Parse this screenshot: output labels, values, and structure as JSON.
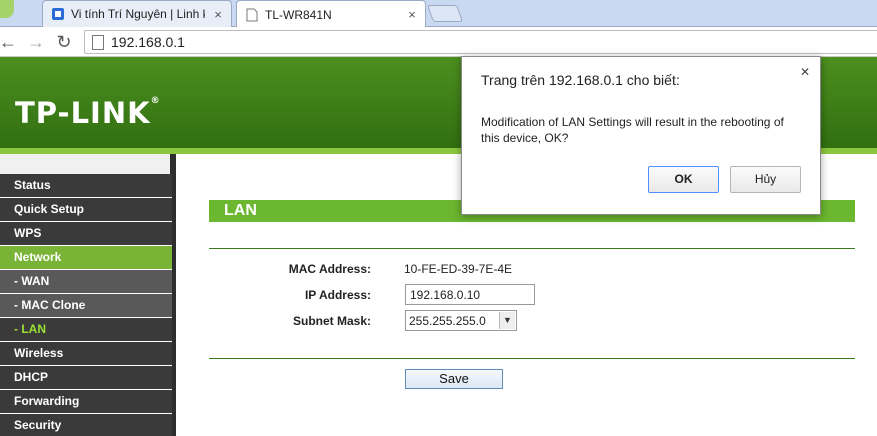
{
  "browser": {
    "tabs": [
      {
        "title": "Vi tính Trí Nguyên | Linh k",
        "active": false
      },
      {
        "title": "TL-WR841N",
        "active": true
      }
    ],
    "address": "192.168.0.1"
  },
  "router": {
    "logo": "TP-LINK",
    "sidebar": [
      {
        "label": "Status",
        "state": "normal"
      },
      {
        "label": "Quick Setup",
        "state": "normal"
      },
      {
        "label": "WPS",
        "state": "normal"
      },
      {
        "label": "Network",
        "state": "active"
      },
      {
        "label": "- WAN",
        "state": "sub"
      },
      {
        "label": "- MAC Clone",
        "state": "sub"
      },
      {
        "label": "- LAN",
        "state": "sub-active"
      },
      {
        "label": "Wireless",
        "state": "normal"
      },
      {
        "label": "DHCP",
        "state": "normal"
      },
      {
        "label": "Forwarding",
        "state": "normal"
      },
      {
        "label": "Security",
        "state": "normal"
      }
    ],
    "section_title": "LAN",
    "fields": {
      "mac_label": "MAC Address:",
      "mac_value": "10-FE-ED-39-7E-4E",
      "ip_label": "IP Address:",
      "ip_value": "192.168.0.10",
      "mask_label": "Subnet Mask:",
      "mask_value": "255.255.255.0"
    },
    "save_label": "Save"
  },
  "dialog": {
    "title": "Trang trên 192.168.0.1 cho biết:",
    "message": "Modification of LAN Settings will result in the rebooting of this device, OK?",
    "ok_label": "OK",
    "cancel_label": "Hủy"
  },
  "colors": {
    "brand_green": "#4d8f1f",
    "active_green": "#7ab437",
    "section_green": "#6bb72f"
  }
}
